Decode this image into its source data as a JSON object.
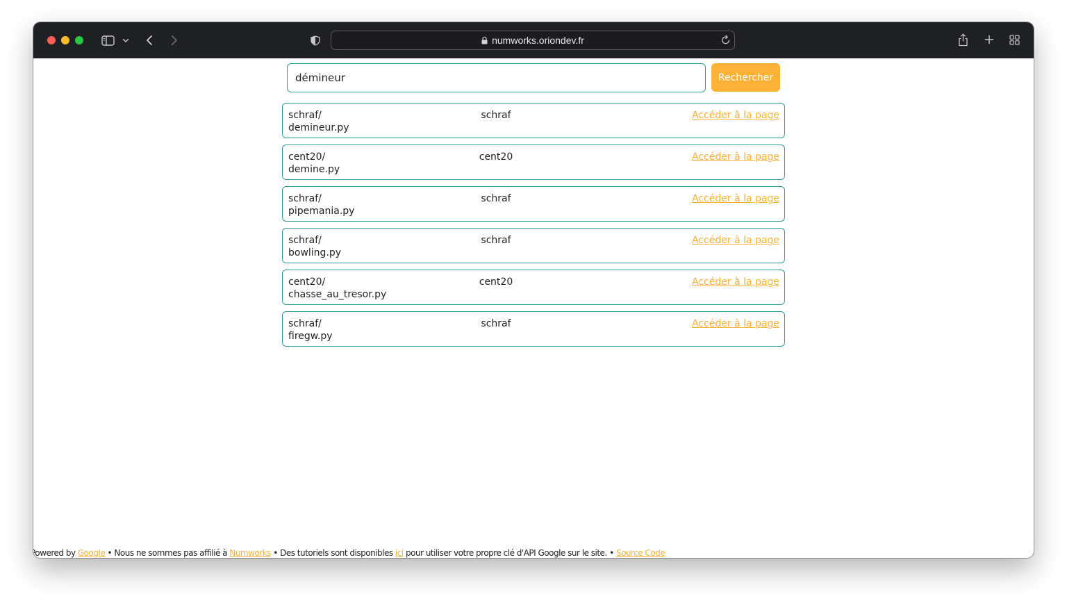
{
  "browser": {
    "url": "numworks.oriondev.fr",
    "traffic_lights": {
      "close": "#ff5f57",
      "minimize": "#febc2e",
      "zoom": "#28c840"
    },
    "icons": [
      "sidebar-icon",
      "chevron-down-icon",
      "back-icon",
      "forward-icon",
      "privacy-shield-icon",
      "lock-icon",
      "reload-icon",
      "share-icon",
      "new-tab-icon",
      "tab-overview-icon"
    ]
  },
  "search": {
    "value": "démineur",
    "button_label": "Rechercher"
  },
  "results": [
    {
      "path_line1": "schraf/",
      "path_line2": "demineur.py",
      "author": "schraf",
      "link": "Accéder à la page"
    },
    {
      "path_line1": "cent20/",
      "path_line2": "demine.py",
      "author": "cent20",
      "link": "Accéder à la page"
    },
    {
      "path_line1": "schraf/",
      "path_line2": "pipemania.py",
      "author": "schraf",
      "link": "Accéder à la page"
    },
    {
      "path_line1": "schraf/",
      "path_line2": "bowling.py",
      "author": "schraf",
      "link": "Accéder à la page"
    },
    {
      "path_line1": "cent20/",
      "path_line2": "chasse_au_tresor.py",
      "author": "cent20",
      "link": "Accéder à la page"
    },
    {
      "path_line1": "schraf/",
      "path_line2": "firegw.py",
      "author": "schraf",
      "link": "Accéder à la page"
    }
  ],
  "footer": {
    "t1": "Powered by ",
    "google_link": "Google",
    "t2": " • Nous ne sommes pas affilié à ",
    "numworks_link": "Numworks",
    "t3": " • Des tutoriels sont disponibles ",
    "ici_link": "ici",
    "t4": " pour utiliser votre propre clé d'API Google sur le site. • ",
    "source_link": "Source Code"
  },
  "colors": {
    "accent": "#fbb136",
    "border": "#2a9e94",
    "toolbar": "#1f2023"
  }
}
